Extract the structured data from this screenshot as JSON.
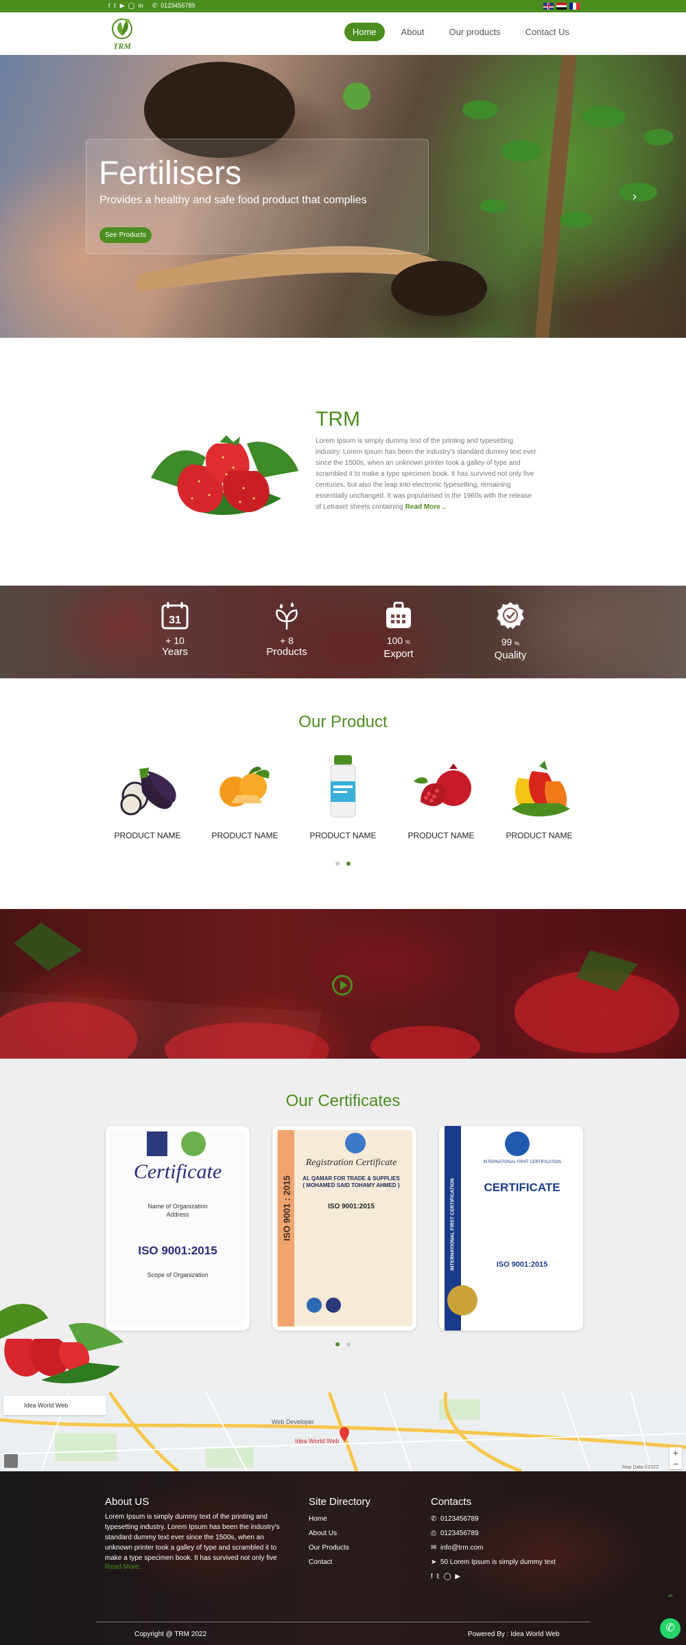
{
  "topbar": {
    "social_icons": [
      "facebook-icon",
      "twitter-icon",
      "youtube-icon",
      "instagram-icon",
      "linkedin-icon"
    ],
    "phone": "0123456789",
    "languages": [
      "English",
      "Arabic",
      "French"
    ]
  },
  "nav": {
    "logo_text": "TRM",
    "items": [
      "Home",
      "About",
      "Our products",
      "Contact Us"
    ],
    "active": "Home"
  },
  "hero": {
    "title": "Fertilisers",
    "subtitle": "Provides a healthy and safe food product that complies",
    "button": "See Products"
  },
  "about": {
    "title": "TRM",
    "text": "Lorem Ipsum is simply dummy text of the printing and typesetting industry. Lorem Ipsum has been the industry's standard dummy text ever since the 1500s, when an unknown printer took a galley of type and scrambled it to make a type specimen book. It has survived not only five centuries, but also the leap into electronic typesetting, remaining essentially unchanged. It was popularised in the 1960s with the release of Letraset sheets containing",
    "read_more": "Read More .."
  },
  "stats": [
    {
      "number": "10",
      "prefix": "+",
      "suffix": "",
      "label": "Years",
      "icon": "calendar-icon"
    },
    {
      "number": "8",
      "prefix": "+",
      "suffix": "",
      "label": "Products",
      "icon": "plant-drops-icon"
    },
    {
      "number": "100",
      "prefix": "",
      "suffix": "%",
      "label": "Export",
      "icon": "export-box-icon"
    },
    {
      "number": "99",
      "prefix": "",
      "suffix": "%",
      "label": "Quality",
      "icon": "quality-badge-icon"
    }
  ],
  "products": {
    "title": "Our Product",
    "items": [
      {
        "name": "PRODUCT NAME",
        "image": "eggplant"
      },
      {
        "name": "PRODUCT NAME",
        "image": "oranges"
      },
      {
        "name": "PRODUCT NAME",
        "image": "bottle"
      },
      {
        "name": "PRODUCT NAME",
        "image": "pomegranate"
      },
      {
        "name": "PRODUCT NAME",
        "image": "peppers"
      }
    ]
  },
  "certificates": {
    "title": "Our Certificates",
    "items": [
      {
        "heading": "Certificate",
        "line1": "Name of Organization",
        "line2": "Address",
        "standard": "ISO 9001:2015",
        "scope": "Scope of Organization"
      },
      {
        "heading": "Registration Certificate",
        "company": "AL QAMAR FOR TRADE & SUPPLIES",
        "person": "( MOHAMED SAID TOHAMY AHMED )",
        "standard": "ISO 9001:2015",
        "side": "ISO 9001 : 2015"
      },
      {
        "heading": "CERTIFICATE",
        "org": "INTERNATIONAL FIRST CERTIFICATION",
        "standard": "ISO 9001:2015",
        "side": "INTERNATIONAL FIRST CERTIFICATION"
      }
    ]
  },
  "map": {
    "label": "Idea World Web",
    "places": [
      "Web Developer",
      "Idea World Web"
    ],
    "zoom_in": "+",
    "zoom_out": "−",
    "credit": "Map Data ©2022"
  },
  "footer": {
    "about_title": "About US",
    "about_text": "Lorem Ipsum is simply dummy text of the printing and typesetting industry. Lorem Ipsum has been the industry's standard dummy text ever since the 1500s, when an unknown printer took a galley of type and scrambled it to make a type specimen book. It has survived not only five",
    "about_more": "Read More..",
    "directory_title": "Site Directory",
    "directory": [
      "Home",
      "About Us",
      "Our Products",
      "Contact"
    ],
    "contacts_title": "Contacts",
    "phone1": "0123456789",
    "phone2": "0123456789",
    "email": "info@trm.com",
    "address": "50 Lorem Ipsum is simply dummy text",
    "copyright": "Copyright @ TRM 2022",
    "powered": "Powered By : Idea World Web"
  },
  "colors": {
    "brand_green": "#4c8d1f",
    "whatsapp": "#25d366"
  }
}
